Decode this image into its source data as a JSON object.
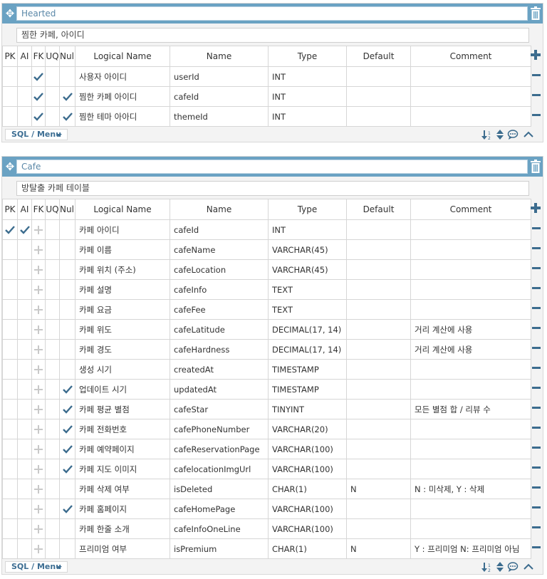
{
  "colors": {
    "accent": "#6aa2c3",
    "check": "#3c6c8e",
    "placeholder": "#c9c9c9"
  },
  "columns": {
    "pk": "PK",
    "ai": "AI",
    "fk": "FK",
    "uq": "UQ",
    "null": "Null",
    "logical": "Logical Name",
    "name": "Name",
    "type": "Type",
    "default": "Default",
    "comment": "Comment"
  },
  "sql_menu_label": "SQL / Menu",
  "tables": [
    {
      "title": "Hearted",
      "comment": "찜한 카페, 아이디",
      "rows": [
        {
          "pk": false,
          "ai": false,
          "fk": true,
          "uq": false,
          "null": false,
          "logical": "사용자 아이디",
          "name": "userId",
          "type": "INT",
          "default": "",
          "comment": ""
        },
        {
          "pk": false,
          "ai": false,
          "fk": true,
          "uq": false,
          "null": true,
          "logical": "찜한 카페 아이디",
          "name": "cafeId",
          "type": "INT",
          "default": "",
          "comment": ""
        },
        {
          "pk": false,
          "ai": false,
          "fk": true,
          "uq": false,
          "null": true,
          "logical": "찜한 테마 아아디",
          "name": "themeId",
          "type": "INT",
          "default": "",
          "comment": ""
        }
      ]
    },
    {
      "title": "Cafe",
      "comment": "방탈출 카페 테이블",
      "rows": [
        {
          "pk": true,
          "ai": true,
          "fk": false,
          "uq": false,
          "null": false,
          "logical": "카페 아이디",
          "name": "cafeId",
          "type": "INT",
          "default": "",
          "comment": ""
        },
        {
          "pk": false,
          "ai": false,
          "fk": false,
          "uq": false,
          "null": false,
          "logical": "카페 이름",
          "name": "cafeName",
          "type": "VARCHAR(45)",
          "default": "",
          "comment": ""
        },
        {
          "pk": false,
          "ai": false,
          "fk": false,
          "uq": false,
          "null": false,
          "logical": "카페 위치 (주소)",
          "name": "cafeLocation",
          "type": "VARCHAR(45)",
          "default": "",
          "comment": ""
        },
        {
          "pk": false,
          "ai": false,
          "fk": false,
          "uq": false,
          "null": false,
          "logical": "카페 설명",
          "name": "cafeInfo",
          "type": "TEXT",
          "default": "",
          "comment": ""
        },
        {
          "pk": false,
          "ai": false,
          "fk": false,
          "uq": false,
          "null": false,
          "logical": "카페 요금",
          "name": "cafeFee",
          "type": "TEXT",
          "default": "",
          "comment": ""
        },
        {
          "pk": false,
          "ai": false,
          "fk": false,
          "uq": false,
          "null": false,
          "logical": "카페 위도",
          "name": "cafeLatitude",
          "type": "DECIMAL(17, 14)",
          "default": "",
          "comment": "거리 계산에 사용"
        },
        {
          "pk": false,
          "ai": false,
          "fk": false,
          "uq": false,
          "null": false,
          "logical": "카페 경도",
          "name": "cafeHardness",
          "type": "DECIMAL(17, 14)",
          "default": "",
          "comment": "거리 계산에 사용"
        },
        {
          "pk": false,
          "ai": false,
          "fk": false,
          "uq": false,
          "null": false,
          "logical": "생성 시기",
          "name": "createdAt",
          "type": "TIMESTAMP",
          "default": "",
          "comment": ""
        },
        {
          "pk": false,
          "ai": false,
          "fk": false,
          "uq": false,
          "null": true,
          "logical": "업데이트 시기",
          "name": "updatedAt",
          "type": "TIMESTAMP",
          "default": "",
          "comment": ""
        },
        {
          "pk": false,
          "ai": false,
          "fk": false,
          "uq": false,
          "null": true,
          "logical": "카페 평균 별점",
          "name": "cafeStar",
          "type": "TINYINT",
          "default": "",
          "comment": "모든 별점 합 / 리뷰 수"
        },
        {
          "pk": false,
          "ai": false,
          "fk": false,
          "uq": false,
          "null": true,
          "logical": "카페 전화번호",
          "name": "cafePhoneNumber",
          "type": "VARCHAR(20)",
          "default": "",
          "comment": ""
        },
        {
          "pk": false,
          "ai": false,
          "fk": false,
          "uq": false,
          "null": true,
          "logical": "카페 예약페이지",
          "name": "cafeReservationPage",
          "type": "VARCHAR(100)",
          "default": "",
          "comment": ""
        },
        {
          "pk": false,
          "ai": false,
          "fk": false,
          "uq": false,
          "null": true,
          "logical": "카페 지도 이미지",
          "name": "cafelocationImgUrl",
          "type": "VARCHAR(100)",
          "default": "",
          "comment": ""
        },
        {
          "pk": false,
          "ai": false,
          "fk": false,
          "uq": false,
          "null": false,
          "logical": "카페 삭제 여부",
          "name": "isDeleted",
          "type": "CHAR(1)",
          "default": "N",
          "comment": "N : 미삭제, Y : 삭제"
        },
        {
          "pk": false,
          "ai": false,
          "fk": false,
          "uq": false,
          "null": true,
          "logical": "카페 홈페이지",
          "name": "cafeHomePage",
          "type": "VARCHAR(100)",
          "default": "",
          "comment": ""
        },
        {
          "pk": false,
          "ai": false,
          "fk": false,
          "uq": false,
          "null": false,
          "logical": "카페 한줄 소개",
          "name": "cafeInfoOneLine",
          "type": "VARCHAR(100)",
          "default": "",
          "comment": ""
        },
        {
          "pk": false,
          "ai": false,
          "fk": false,
          "uq": false,
          "null": false,
          "logical": "프리미엄 여부",
          "name": "isPremium",
          "type": "CHAR(1)",
          "default": "N",
          "comment": "Y : 프리미엄 N: 프리미엄 아님"
        }
      ]
    }
  ]
}
